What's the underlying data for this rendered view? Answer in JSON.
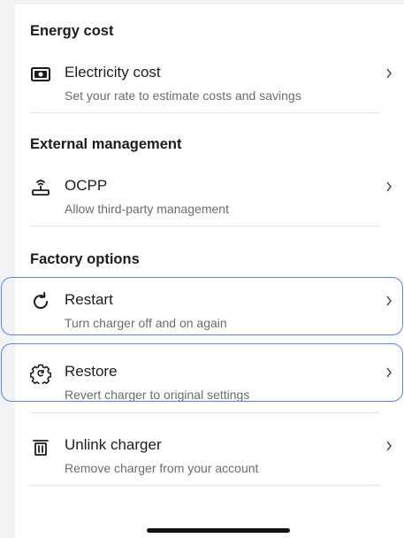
{
  "sections": {
    "energy": {
      "title": "Energy cost",
      "items": [
        {
          "label": "Electricity cost",
          "description": "Set your rate to estimate costs and savings",
          "icon": "cash-icon"
        }
      ]
    },
    "external": {
      "title": "External management",
      "items": [
        {
          "label": "OCPP",
          "description": "Allow third-party management",
          "icon": "antenna-icon"
        }
      ]
    },
    "factory": {
      "title": "Factory options",
      "items": [
        {
          "label": "Restart",
          "description": "Turn charger off and on again",
          "icon": "restart-icon",
          "focused": true
        },
        {
          "label": "Restore",
          "description": "Revert charger to original settings",
          "icon": "gear-restore-icon",
          "focused": true
        },
        {
          "label": "Unlink charger",
          "description": "Remove charger from your account",
          "icon": "trash-icon"
        }
      ]
    }
  },
  "colors": {
    "background": "#f2f2f4",
    "panel": "#ffffff",
    "focus_ring": "#5b86d6",
    "text_primary": "#1c1c1e",
    "text_secondary": "#6b6b70"
  }
}
